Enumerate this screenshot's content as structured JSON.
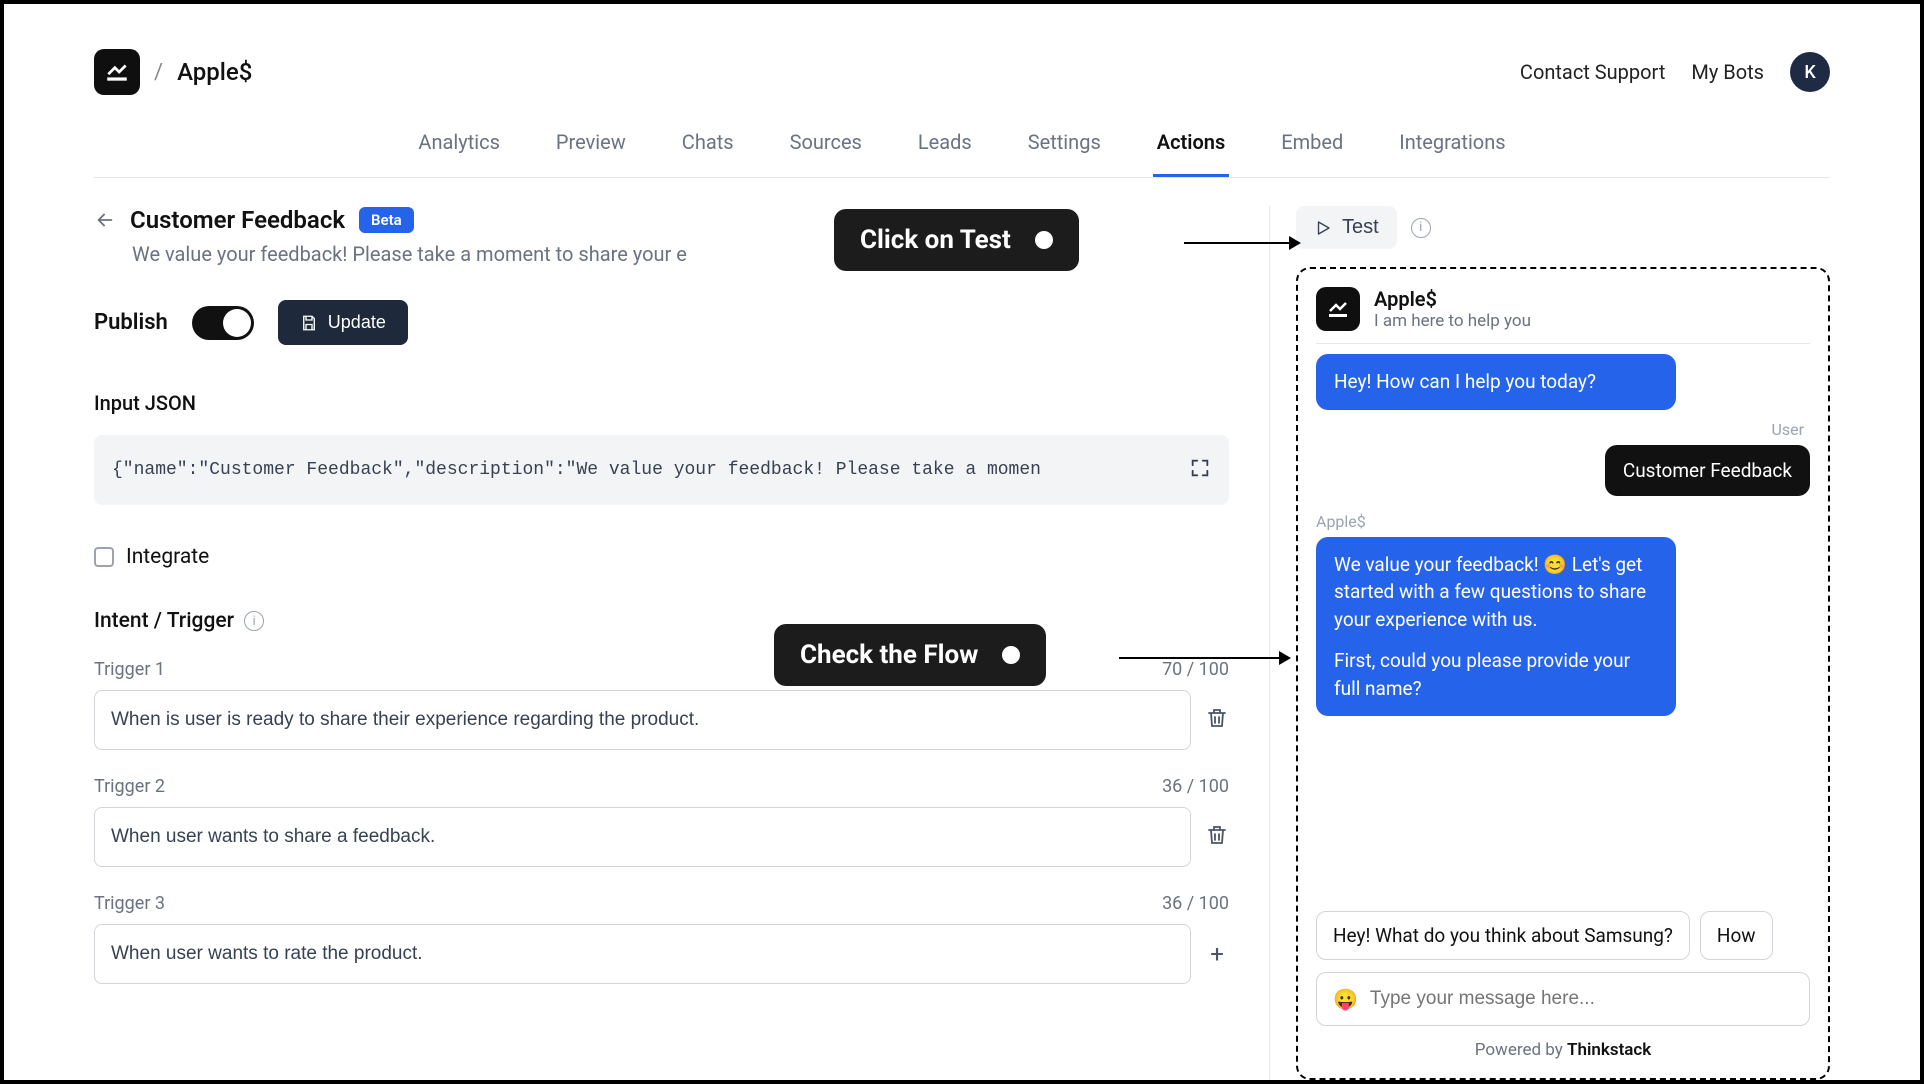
{
  "topbar": {
    "workspace_name": "Apple$",
    "contact_support": "Contact Support",
    "my_bots": "My Bots",
    "avatar_initial": "K"
  },
  "tabs": [
    "Analytics",
    "Preview",
    "Chats",
    "Sources",
    "Leads",
    "Settings",
    "Actions",
    "Embed",
    "Integrations"
  ],
  "active_tab": "Actions",
  "action": {
    "title": "Customer Feedback",
    "beta": "Beta",
    "subtitle": "We value your feedback! Please take a moment to share your e",
    "publish_label": "Publish",
    "update_label": "Update"
  },
  "input_json": {
    "label": "Input JSON",
    "value": "{\"name\":\"Customer Feedback\",\"description\":\"We value your feedback! Please take a momen"
  },
  "integrate": {
    "label": "Integrate"
  },
  "intent": {
    "label": "Intent / Trigger"
  },
  "triggers": [
    {
      "label": "Trigger 1",
      "count": "70 / 100",
      "value": "When is user is ready to share their experience regarding the product."
    },
    {
      "label": "Trigger 2",
      "count": "36 / 100",
      "value": "When user wants to share a feedback."
    },
    {
      "label": "Trigger 3",
      "count": "36 / 100",
      "value": "When user wants to rate the product."
    }
  ],
  "test_button": "Test",
  "chat": {
    "title": "Apple$",
    "subtitle": "I am here to help you",
    "greeting": "Hey! How can I help you today?",
    "user_label": "User",
    "user_msg": "Customer Feedback",
    "bot_label": "Apple$",
    "bot_msg_1": "We value your feedback! 😊 Let's get started with a few questions to share your experience with us.",
    "bot_msg_2": "First, could you please provide your full name?",
    "suggestions": [
      "Hey! What do you think about Samsung?",
      "How"
    ],
    "input_placeholder": "Type your message here...",
    "powered_prefix": "Powered by ",
    "powered_brand": "Thinkstack"
  },
  "callouts": {
    "test": "Click on Test",
    "flow": "Check the Flow"
  }
}
